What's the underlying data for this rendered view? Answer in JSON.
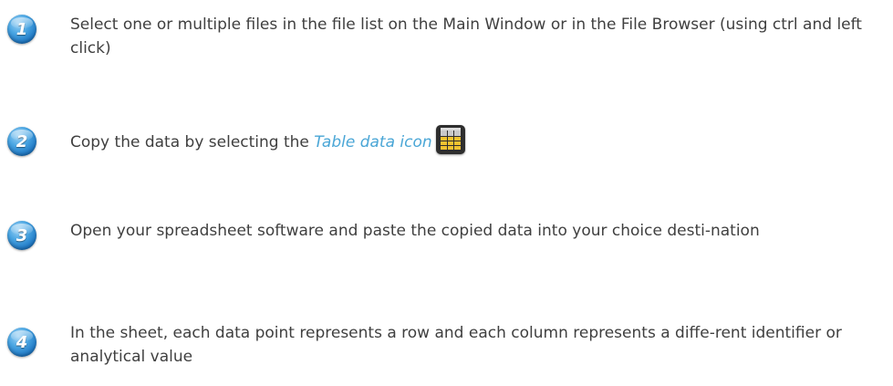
{
  "steps": [
    {
      "number": "1",
      "text": "Select one or multiple files in the file list on the Main Window or in the File Browser (using ctrl and left click)"
    },
    {
      "number": "2",
      "text_before": "Copy the data by selecting the",
      "emphasis": "Table data icon",
      "icon": "table-data-icon"
    },
    {
      "number": "3",
      "text": "Open your spreadsheet software and paste the copied data into your choice desti-nation"
    },
    {
      "number": "4",
      "text": "In the sheet, each data point represents a row and each column represents a diffe-rent identifier or analytical value"
    }
  ],
  "colors": {
    "badge": "#1f78c4",
    "emphasis": "#4aa6d6",
    "text": "#3f3f3f",
    "icon_fill": "#f2c230"
  }
}
